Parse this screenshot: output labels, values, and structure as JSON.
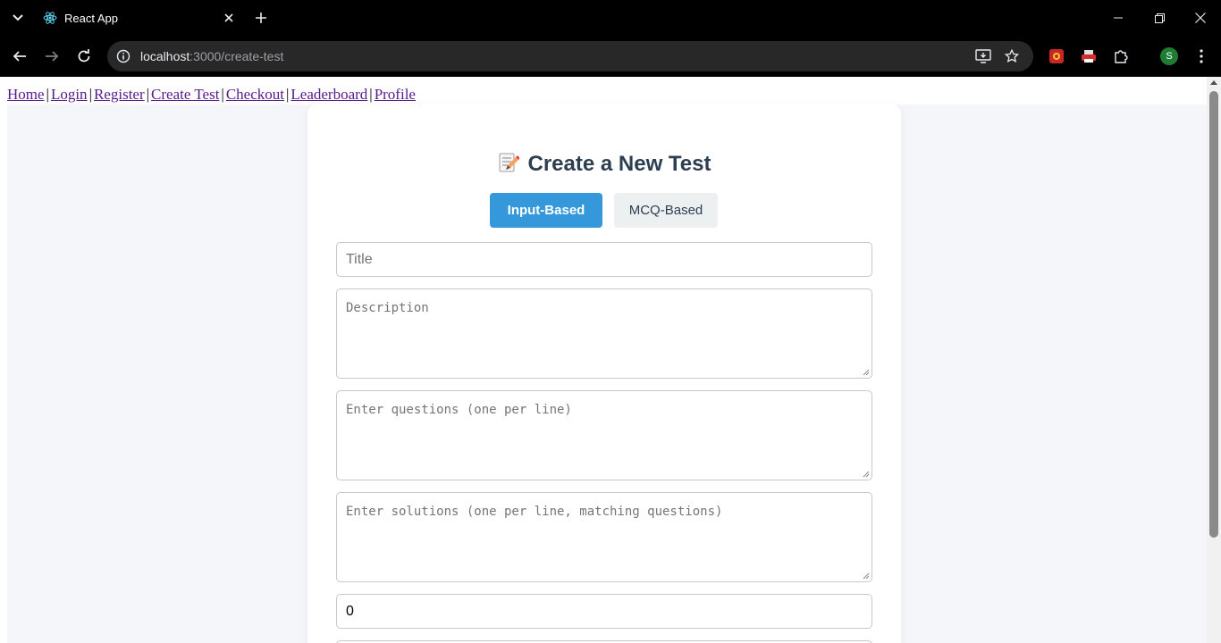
{
  "browser": {
    "tab_title": "React App",
    "url_host": "localhost",
    "url_path": ":3000/create-test",
    "profile_initial": "S"
  },
  "nav": {
    "links": [
      "Home",
      "Login",
      "Register",
      "Create Test",
      "Checkout",
      "Leaderboard",
      "Profile"
    ],
    "separator": "|"
  },
  "form": {
    "heading": "Create a New Test",
    "heading_emoji": "memo-icon",
    "mode_buttons": [
      "Input-Based",
      "MCQ-Based"
    ],
    "active_mode": "Input-Based",
    "title_placeholder": "Title",
    "description_placeholder": "Description",
    "questions_placeholder": "Enter questions (one per line)",
    "solutions_placeholder": "Enter solutions (one per line, matching questions)",
    "number_value": "0"
  },
  "colors": {
    "primary": "#3498db",
    "secondary": "#ecf0f1",
    "heading": "#2c3e50",
    "link": "#551a8b",
    "page_bg": "#f4f6fa"
  }
}
